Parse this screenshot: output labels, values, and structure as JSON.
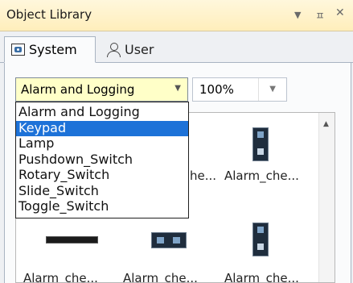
{
  "panel": {
    "title": "Object Library",
    "icons": [
      "chevron-down-icon",
      "pin-icon",
      "close-icon"
    ],
    "dropdown_glyph": "▼",
    "pin_glyph": "ㅍ",
    "close_glyph": "✕"
  },
  "tabs": [
    {
      "label": "System",
      "icon": "system-icon",
      "active": true
    },
    {
      "label": "User",
      "icon": "user-icon",
      "active": false
    }
  ],
  "category_select": {
    "value": "Alarm and Logging",
    "arrow": "▼"
  },
  "zoom_select": {
    "value": "100%",
    "arrow": "▼"
  },
  "dropdown": {
    "options": [
      "Alarm and Logging",
      "Keypad",
      "Lamp",
      "Pushdown_Switch",
      "Rotary_Switch",
      "Slide_Switch",
      "Toggle_Switch"
    ],
    "selected_index": 1
  },
  "library_items": {
    "row1": [
      {
        "label": "he..."
      },
      {
        "label": "Alarm_che..."
      }
    ],
    "row2": [
      {
        "label": "Alarm_che..."
      },
      {
        "label": "Alarm_che..."
      },
      {
        "label": "Alarm_che..."
      }
    ]
  },
  "scrollbar": {
    "up_arrow": "▲"
  },
  "colors": {
    "title_bg": "#ffeebb",
    "combo_bg": "#ffffc8",
    "selection": "#1d72d8"
  }
}
